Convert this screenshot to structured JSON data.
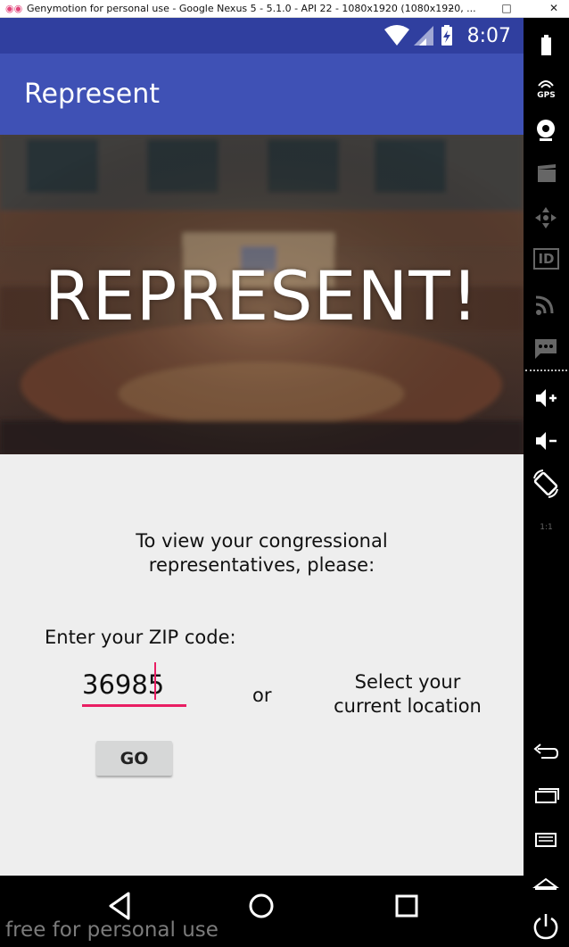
{
  "window": {
    "app_icon": "genymotion-icon",
    "title": "Genymotion for personal use - Google Nexus 5 - 5.1.0 - API 22 - 1080x1920 (1080x1920, ...",
    "minimize_icon": "minimize-icon",
    "maximize_icon": "maximize-icon",
    "close_icon": "close-icon"
  },
  "statusbar": {
    "icons": [
      "wifi-icon",
      "signal-icon",
      "battery-charging-icon"
    ],
    "time": "8:07"
  },
  "appbar": {
    "title": "Represent"
  },
  "hero": {
    "text": "REPRESENT!",
    "image": "congress-chamber-photo"
  },
  "main": {
    "instruction": "To view your congressional representatives, please:",
    "zip_label": "Enter your ZIP code:",
    "zip_value": "36985",
    "or_label": "or",
    "location_label": "Select your current location",
    "go_button": "GO",
    "accent_color": "#e91e63"
  },
  "navbar": {
    "icons": [
      "back-icon",
      "home-icon",
      "recents-icon"
    ]
  },
  "watermark": "free for personal use",
  "sidebar": {
    "items": [
      {
        "icon": "battery-icon",
        "label": ""
      },
      {
        "icon": "gps-icon",
        "label": "GPS"
      },
      {
        "icon": "camera-icon",
        "label": ""
      },
      {
        "icon": "video-capture-icon",
        "label": ""
      },
      {
        "icon": "dpad-icon",
        "label": ""
      },
      {
        "icon": "device-id-icon",
        "label": "ID"
      },
      {
        "icon": "network-icon",
        "label": ""
      },
      {
        "icon": "sms-icon",
        "label": ""
      },
      {
        "icon": "volume-up-icon",
        "label": ""
      },
      {
        "icon": "volume-down-icon",
        "label": ""
      },
      {
        "icon": "rotate-icon",
        "label": ""
      },
      {
        "icon": "pixel-perfect-icon",
        "label": "1:1"
      },
      {
        "icon": "back-icon",
        "label": ""
      },
      {
        "icon": "recent-apps-icon",
        "label": ""
      },
      {
        "icon": "menu-icon",
        "label": ""
      },
      {
        "icon": "home-icon",
        "label": ""
      },
      {
        "icon": "power-icon",
        "label": ""
      }
    ]
  }
}
